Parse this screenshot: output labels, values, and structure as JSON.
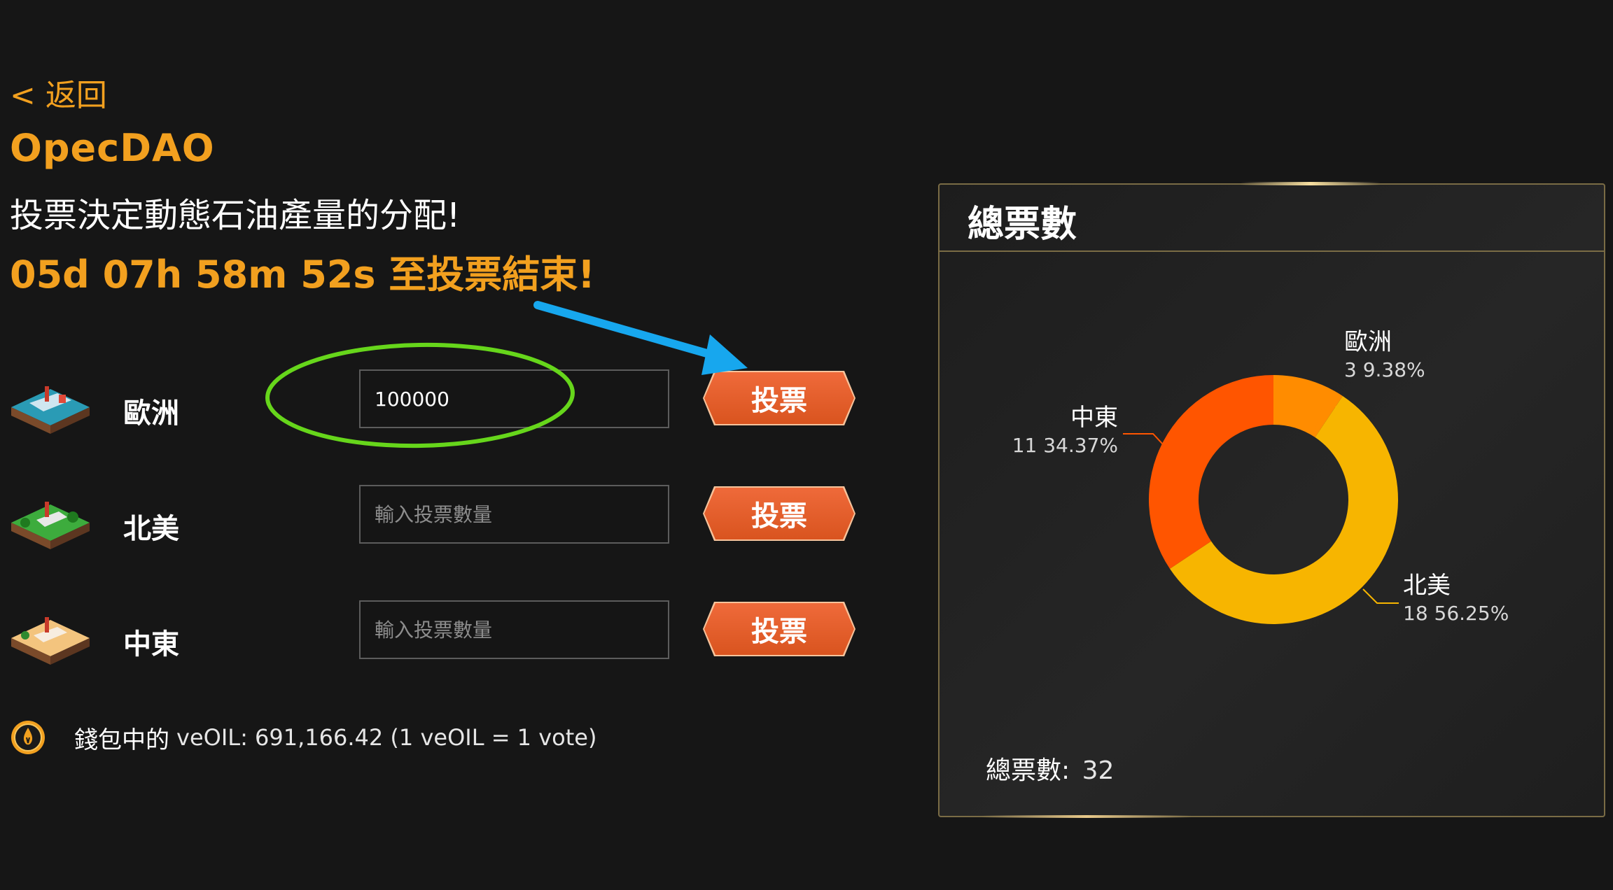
{
  "header": {
    "back_label": "< 返回",
    "dao_name": "OpecDAO",
    "subtitle": "投票決定動態石油產量的分配!",
    "countdown": "05d 07h 58m 52s 至投票結束!"
  },
  "regions": [
    {
      "name": "歐洲",
      "input_value": "100000",
      "input_placeholder": "輸入投票數量",
      "button_label": "投票",
      "tile_color": "#2a9bb5"
    },
    {
      "name": "北美",
      "input_value": "",
      "input_placeholder": "輸入投票數量",
      "button_label": "投票",
      "tile_color": "#3dac3d"
    },
    {
      "name": "中東",
      "input_value": "",
      "input_placeholder": "輸入投票數量",
      "button_label": "投票",
      "tile_color": "#f3c47e"
    }
  ],
  "wallet": {
    "label": "錢包中的",
    "detail": "veOIL: 691,166.42 (1 veOIL = 1 vote)"
  },
  "panel": {
    "title": "總票數",
    "total_label": "總票數:",
    "total_value": "32"
  },
  "chart_data": {
    "type": "pie",
    "donut": true,
    "slices": [
      {
        "name": "歐洲",
        "value": 3,
        "percent_label": "9.38%",
        "color": "#ff8c00"
      },
      {
        "name": "北美",
        "value": 18,
        "percent_label": "56.25%",
        "color": "#f7b500"
      },
      {
        "name": "中東",
        "value": 11,
        "percent_label": "34.37%",
        "color": "#ff5500"
      }
    ]
  },
  "annotations": {
    "arrow_color": "#17a7ee",
    "circle_color": "#66d61b"
  }
}
